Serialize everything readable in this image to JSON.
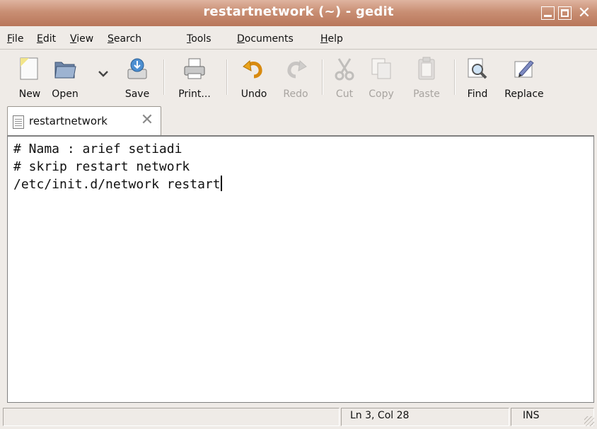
{
  "window": {
    "title": "restartnetwork (~) - gedit"
  },
  "menu": [
    {
      "mnemonic": "F",
      "rest": "ile"
    },
    {
      "mnemonic": "E",
      "rest": "dit"
    },
    {
      "mnemonic": "V",
      "rest": "iew"
    },
    {
      "mnemonic": "S",
      "rest": "earch"
    },
    {
      "mnemonic": "T",
      "rest": "ools"
    },
    {
      "mnemonic": "D",
      "rest": "ocuments"
    },
    {
      "mnemonic": "H",
      "rest": "elp"
    }
  ],
  "toolbar": {
    "new": "New",
    "open": "Open",
    "save": "Save",
    "print": "Print...",
    "undo": "Undo",
    "redo": "Redo",
    "cut": "Cut",
    "copy": "Copy",
    "paste": "Paste",
    "find": "Find",
    "replace": "Replace"
  },
  "tab": {
    "label": "restartnetwork"
  },
  "document": {
    "lines": [
      "# Nama : arief setiadi",
      "# skrip restart network",
      "/etc/init.d/network restart"
    ]
  },
  "status": {
    "position": "Ln 3, Col 28",
    "mode": "INS"
  },
  "colors": {
    "titlebar": "#c98f74",
    "window_bg": "#efebe7",
    "disabled_text": "#a8a4a0"
  }
}
